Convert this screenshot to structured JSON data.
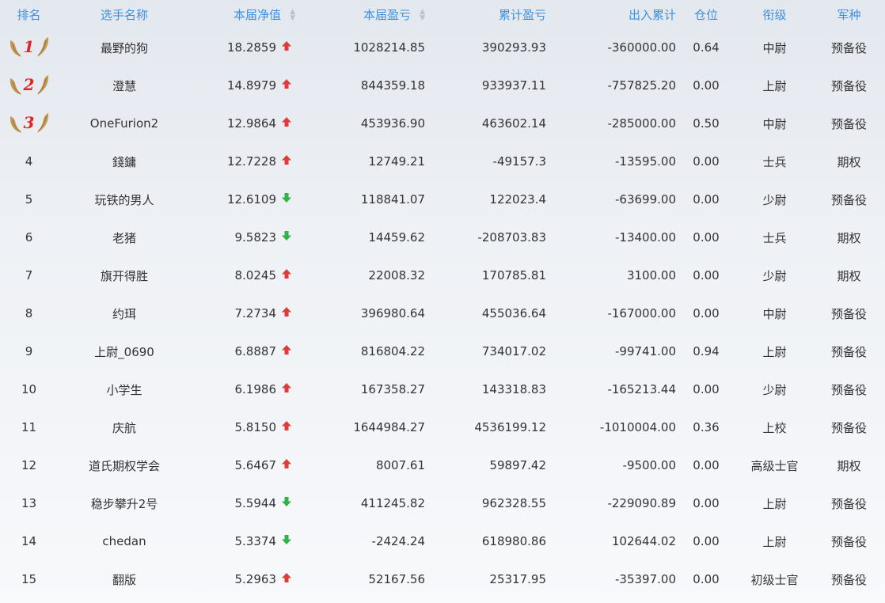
{
  "colors": {
    "header_text": "#3f8fe0",
    "up": "#e03a3a",
    "down": "#2fb34a",
    "rank_num": "#e02424",
    "wing": "#c49a54"
  },
  "headers": {
    "rank": "排名",
    "name": "选手名称",
    "net_value": "本届净值",
    "profit": "本届盈亏",
    "total_profit": "累计盈亏",
    "in_out": "出入累计",
    "position": "仓位",
    "title": "衔级",
    "branch": "军种"
  },
  "sortable_columns": [
    "net_value",
    "profit"
  ],
  "rows": [
    {
      "rank": "1",
      "medal": true,
      "name": "最野的狗",
      "net_value": "18.2859",
      "trend": "up",
      "profit": "1028214.85",
      "total_profit": "390293.93",
      "in_out": "-360000.00",
      "position": "0.64",
      "title": "中尉",
      "branch": "预备役"
    },
    {
      "rank": "2",
      "medal": true,
      "name": "澄慧",
      "net_value": "14.8979",
      "trend": "up",
      "profit": "844359.18",
      "total_profit": "933937.11",
      "in_out": "-757825.20",
      "position": "0.00",
      "title": "上尉",
      "branch": "预备役"
    },
    {
      "rank": "3",
      "medal": true,
      "name": "OneFurion2",
      "net_value": "12.9864",
      "trend": "up",
      "profit": "453936.90",
      "total_profit": "463602.14",
      "in_out": "-285000.00",
      "position": "0.50",
      "title": "中尉",
      "branch": "预备役"
    },
    {
      "rank": "4",
      "medal": false,
      "name": "錢鏞",
      "net_value": "12.7228",
      "trend": "up",
      "profit": "12749.21",
      "total_profit": "-49157.3",
      "in_out": "-13595.00",
      "position": "0.00",
      "title": "士兵",
      "branch": "期权"
    },
    {
      "rank": "5",
      "medal": false,
      "name": "玩铁的男人",
      "net_value": "12.6109",
      "trend": "down",
      "profit": "118841.07",
      "total_profit": "122023.4",
      "in_out": "-63699.00",
      "position": "0.00",
      "title": "少尉",
      "branch": "预备役"
    },
    {
      "rank": "6",
      "medal": false,
      "name": "老猪",
      "net_value": "9.5823",
      "trend": "down",
      "profit": "14459.62",
      "total_profit": "-208703.83",
      "in_out": "-13400.00",
      "position": "0.00",
      "title": "士兵",
      "branch": "期权"
    },
    {
      "rank": "7",
      "medal": false,
      "name": "旗开得胜",
      "net_value": "8.0245",
      "trend": "up",
      "profit": "22008.32",
      "total_profit": "170785.81",
      "in_out": "3100.00",
      "position": "0.00",
      "title": "少尉",
      "branch": "期权"
    },
    {
      "rank": "8",
      "medal": false,
      "name": "约珥",
      "net_value": "7.2734",
      "trend": "up",
      "profit": "396980.64",
      "total_profit": "455036.64",
      "in_out": "-167000.00",
      "position": "0.00",
      "title": "中尉",
      "branch": "预备役"
    },
    {
      "rank": "9",
      "medal": false,
      "name": "上尉_0690",
      "net_value": "6.8887",
      "trend": "up",
      "profit": "816804.22",
      "total_profit": "734017.02",
      "in_out": "-99741.00",
      "position": "0.94",
      "title": "上尉",
      "branch": "预备役"
    },
    {
      "rank": "10",
      "medal": false,
      "name": "小学生",
      "net_value": "6.1986",
      "trend": "up",
      "profit": "167358.27",
      "total_profit": "143318.83",
      "in_out": "-165213.44",
      "position": "0.00",
      "title": "少尉",
      "branch": "预备役"
    },
    {
      "rank": "11",
      "medal": false,
      "name": "庆航",
      "net_value": "5.8150",
      "trend": "up",
      "profit": "1644984.27",
      "total_profit": "4536199.12",
      "in_out": "-1010004.00",
      "position": "0.36",
      "title": "上校",
      "branch": "预备役"
    },
    {
      "rank": "12",
      "medal": false,
      "name": "道氏期权学会",
      "net_value": "5.6467",
      "trend": "up",
      "profit": "8007.61",
      "total_profit": "59897.42",
      "in_out": "-9500.00",
      "position": "0.00",
      "title": "高级士官",
      "branch": "期权"
    },
    {
      "rank": "13",
      "medal": false,
      "name": "稳步攀升2号",
      "net_value": "5.5944",
      "trend": "down",
      "profit": "411245.82",
      "total_profit": "962328.55",
      "in_out": "-229090.89",
      "position": "0.00",
      "title": "上尉",
      "branch": "预备役"
    },
    {
      "rank": "14",
      "medal": false,
      "name": "chedan",
      "net_value": "5.3374",
      "trend": "down",
      "profit": "-2424.24",
      "total_profit": "618980.86",
      "in_out": "102644.02",
      "position": "0.00",
      "title": "上尉",
      "branch": "预备役"
    },
    {
      "rank": "15",
      "medal": false,
      "name": "翻版",
      "net_value": "5.2963",
      "trend": "up",
      "profit": "52167.56",
      "total_profit": "25317.95",
      "in_out": "-35397.00",
      "position": "0.00",
      "title": "初级士官",
      "branch": "预备役"
    }
  ]
}
